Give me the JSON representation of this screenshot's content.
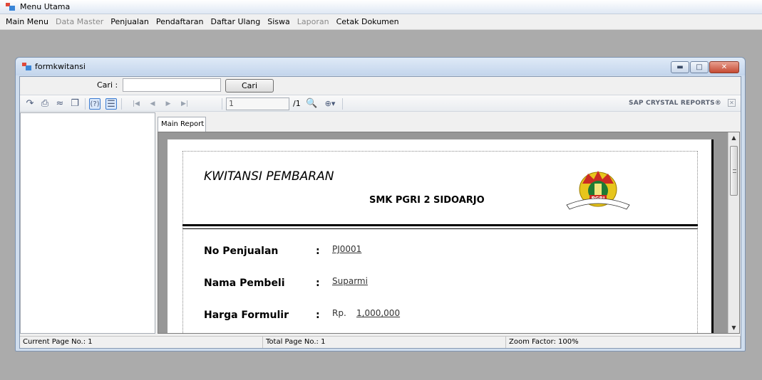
{
  "main_window": {
    "title": "Menu Utama"
  },
  "menu": {
    "items": [
      {
        "label": "Main Menu",
        "enabled": true
      },
      {
        "label": "Data Master",
        "enabled": false
      },
      {
        "label": "Penjualan",
        "enabled": true
      },
      {
        "label": "Pendaftaran",
        "enabled": true
      },
      {
        "label": "Daftar Ulang",
        "enabled": true
      },
      {
        "label": "Siswa",
        "enabled": true
      },
      {
        "label": "Laporan",
        "enabled": false
      },
      {
        "label": "Cetak Dokumen",
        "enabled": true
      }
    ]
  },
  "child_window": {
    "title": "formkwitansi"
  },
  "search": {
    "label": "Cari :",
    "value": "",
    "button_label": "Cari"
  },
  "viewer": {
    "page_input": "1",
    "page_total": "/1",
    "brand": "SAP CRYSTAL REPORTS®",
    "tab_label": "Main Report",
    "toolbar_icons": [
      "export-icon",
      "print-icon",
      "refresh-icon",
      "copy-icon",
      "help-icon",
      "group-tree-toggle-icon",
      "first-page-icon",
      "previous-page-icon",
      "next-page-icon",
      "last-page-icon",
      "find-icon",
      "zoom-icon"
    ]
  },
  "report": {
    "title": "KWITANSI PEMBARAN",
    "school": "SMK PGRI 2 SIDOARJO",
    "logo_text": "PGRI",
    "rows": [
      {
        "label": "No Penjualan",
        "colon": ":",
        "prefix": "",
        "value": "PJ0001"
      },
      {
        "label": "Nama Pembeli",
        "colon": ":",
        "prefix": "",
        "value": "Suparmi"
      },
      {
        "label": "Harga Formulir",
        "colon": ":",
        "prefix": "Rp.",
        "value": "1,000,000"
      }
    ]
  },
  "status": {
    "current_page": "Current Page No.: 1",
    "total_page": "Total Page No.: 1",
    "zoom": "Zoom Factor: 100%"
  },
  "colors": {
    "accent": "#3b7bd1",
    "report_background": "#979797",
    "close_button": "#c54a33"
  }
}
